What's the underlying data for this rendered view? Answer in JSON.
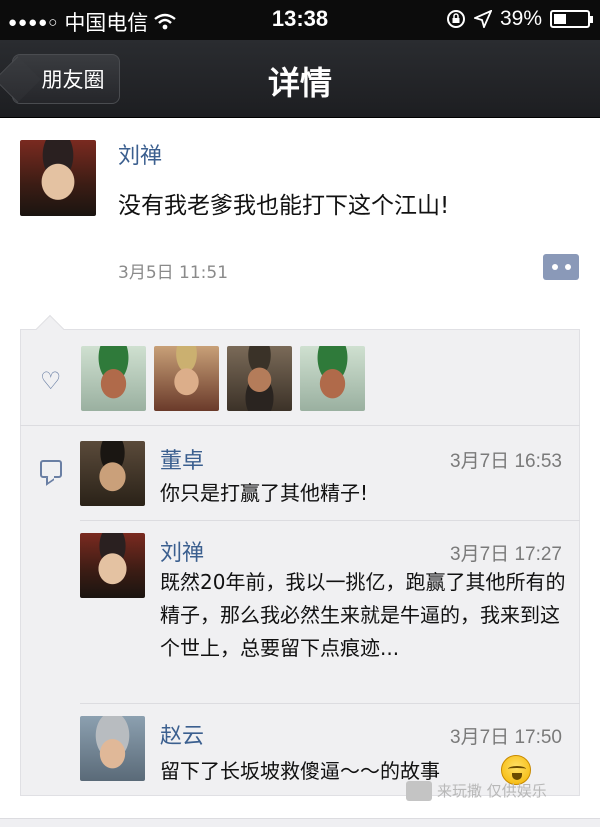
{
  "status_bar": {
    "signal": "●●●●○",
    "carrier": "中国电信",
    "wifi_icon": "wifi-icon",
    "time": "13:38",
    "orientation_lock_icon": "orientation-lock-icon",
    "location_icon": "location-arrow-icon",
    "battery": "39%",
    "battery_level": 0.39
  },
  "nav": {
    "back_label": "朋友圈",
    "title": "详情"
  },
  "post": {
    "author": "刘禅",
    "text": "没有我老爹我也能打下这个江山!",
    "time": "3月5日 11:51",
    "more_icon": "more-dots-icon"
  },
  "likes": {
    "icon": "heart-icon",
    "avatars": [
      "guan-yu-avatar",
      "young-general-avatar",
      "bearded-general-avatar",
      "guan-yu-avatar"
    ]
  },
  "comments": [
    {
      "name": "董卓",
      "time": "3月7日 16:53",
      "text": "你只是打赢了其他精子!"
    },
    {
      "name": "刘禅",
      "time": "3月7日 17:27",
      "text": "既然20年前，我以一挑亿，跑赢了其他所有的精子，那么我必然生来就是牛逼的，我来到这个世上，总要留下点痕迹..."
    },
    {
      "name": "赵云",
      "time": "3月7日 17:50",
      "text": "留下了长坂坡救傻逼～～的故事"
    }
  ],
  "watermark": "来玩撒 仅供娱乐",
  "colors": {
    "name_blue": "#3b5f8f",
    "nav_dark": "#1d1e21",
    "panel_bg": "#f0f0f2"
  }
}
